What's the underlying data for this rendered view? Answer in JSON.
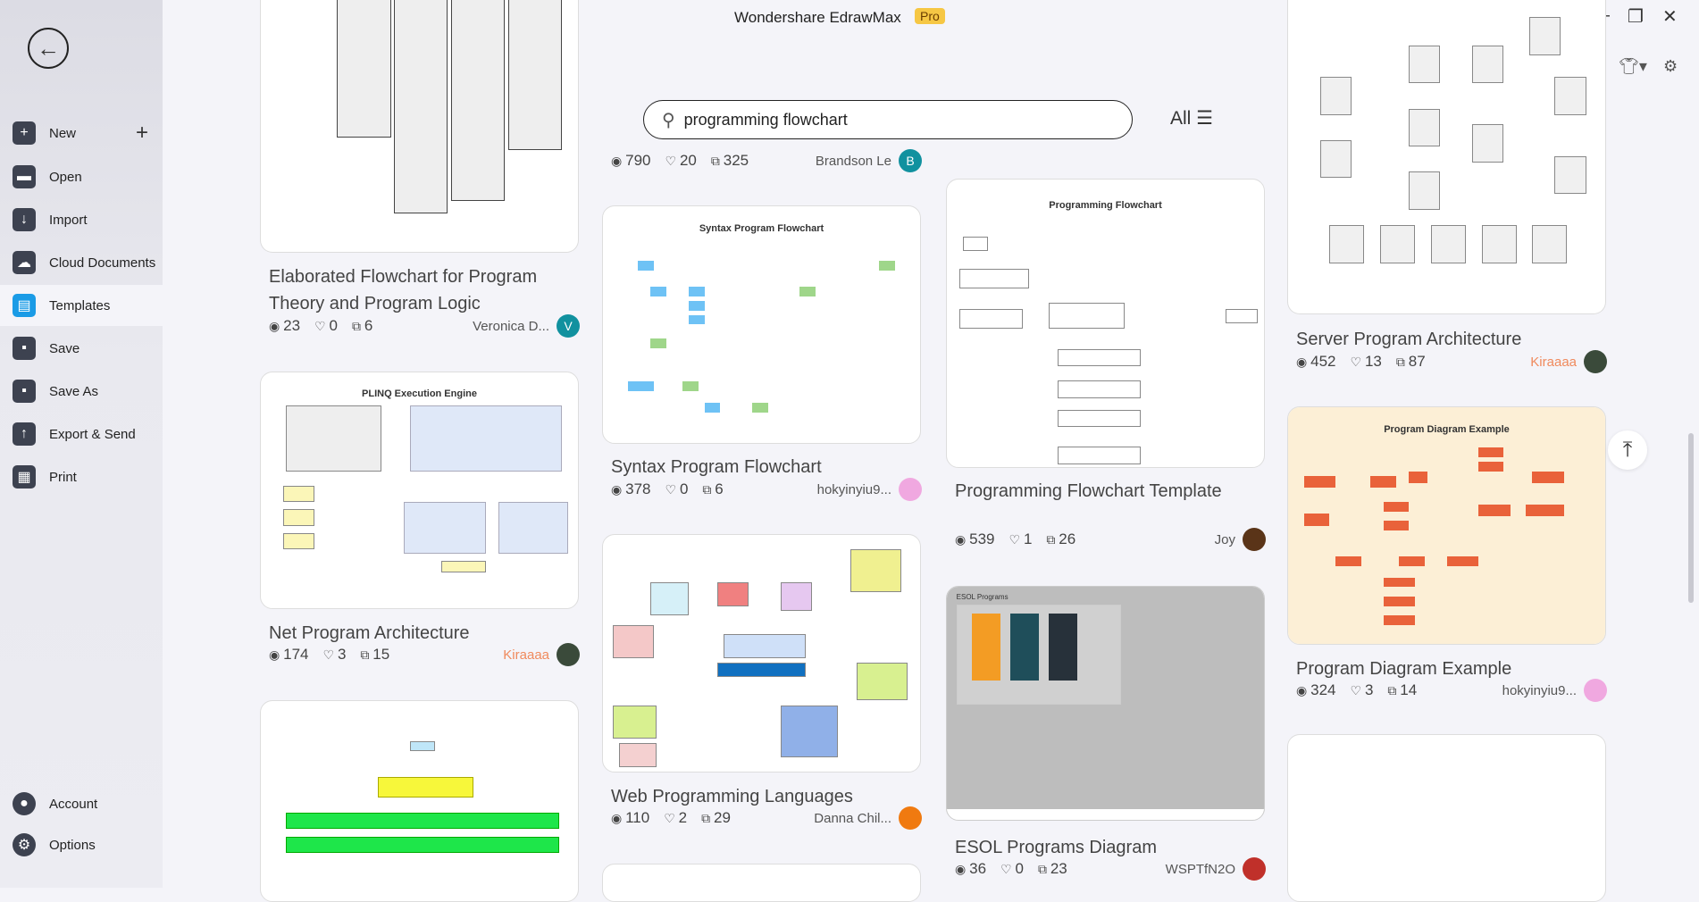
{
  "app": {
    "title": "Wondershare EdrawMax",
    "badge": "Pro"
  },
  "sidebar": {
    "items": [
      {
        "label": "New",
        "icon": "plus-square-icon"
      },
      {
        "label": "Open",
        "icon": "folder-icon"
      },
      {
        "label": "Import",
        "icon": "import-icon"
      },
      {
        "label": "Cloud Documents",
        "icon": "cloud-icon"
      },
      {
        "label": "Templates",
        "icon": "templates-icon"
      },
      {
        "label": "Save",
        "icon": "save-icon"
      },
      {
        "label": "Save As",
        "icon": "save-as-icon"
      },
      {
        "label": "Export & Send",
        "icon": "export-icon"
      },
      {
        "label": "Print",
        "icon": "print-icon"
      }
    ],
    "bottom": [
      {
        "label": "Account",
        "icon": "account-icon"
      },
      {
        "label": "Options",
        "icon": "gear-icon"
      }
    ]
  },
  "search": {
    "value": "programming flowchart",
    "filter": "All"
  },
  "accent": "#1a9be6",
  "cards": [
    {
      "title": "Elaborated Flowchart for Program Theory and Program Logic",
      "views": "23",
      "likes": "0",
      "copies": "6",
      "author": "Veronica D...",
      "avatar": "V",
      "avatar_color": "#11919f",
      "thumb": "doc",
      "thumb_title": ""
    },
    {
      "title": "Net Program Architecture",
      "views": "174",
      "likes": "3",
      "copies": "15",
      "author": "Kiraaaa",
      "author_color": "#f08a5d",
      "avatar": "",
      "avatar_color": "#3a4a3a",
      "thumb": "net",
      "thumb_title": "PLINQ Execution Engine"
    },
    {
      "title": "",
      "views": "",
      "likes": "",
      "copies": "",
      "author": "",
      "thumb": "green",
      "thumb_title": ""
    },
    {
      "title": "",
      "views": "790",
      "likes": "20",
      "copies": "325",
      "author": "Brandson Le",
      "avatar": "B",
      "avatar_color": "#11919f",
      "thumb": "none"
    },
    {
      "title": "Syntax Program Flowchart",
      "views": "378",
      "likes": "0",
      "copies": "6",
      "author": "hokyinyiu9...",
      "avatar": "",
      "avatar_color": "#f0a8e0",
      "thumb": "syntax",
      "thumb_title": "Syntax Program Flowchart"
    },
    {
      "title": "Web Programming Languages",
      "views": "110",
      "likes": "2",
      "copies": "29",
      "author": "Danna Chil...",
      "avatar": "",
      "avatar_color": "#f07a10",
      "thumb": "mind",
      "thumb_title": ""
    },
    {
      "title": "",
      "views": "",
      "likes": "",
      "copies": "",
      "author": "",
      "thumb": "blank"
    },
    {
      "title": "Programming Flowchart Template",
      "views": "539",
      "likes": "1",
      "copies": "26",
      "author": "Joy",
      "avatar": "",
      "avatar_color": "#5a3418",
      "thumb": "flow",
      "thumb_title": "Programming Flowchart"
    },
    {
      "title": "ESOL Programs Diagram",
      "views": "36",
      "likes": "0",
      "copies": "23",
      "author": "WSPTfN2O",
      "avatar": "",
      "avatar_color": "#c0302a",
      "thumb": "gray",
      "thumb_title": "ESOL Programs"
    },
    {
      "title": "Server Program Architecture",
      "views": "452",
      "likes": "13",
      "copies": "87",
      "author": "Kiraaaa",
      "author_color": "#f08a5d",
      "avatar": "",
      "avatar_color": "#3a4a3a",
      "thumb": "server",
      "thumb_title": ""
    },
    {
      "title": "Program Diagram Example",
      "views": "324",
      "likes": "3",
      "copies": "14",
      "author": "hokyinyiu9...",
      "avatar": "",
      "avatar_color": "#f0a8e0",
      "thumb": "cream",
      "thumb_title": "Program Diagram Example"
    },
    {
      "title": "",
      "views": "",
      "likes": "",
      "copies": "",
      "author": "",
      "thumb": "blank"
    }
  ]
}
